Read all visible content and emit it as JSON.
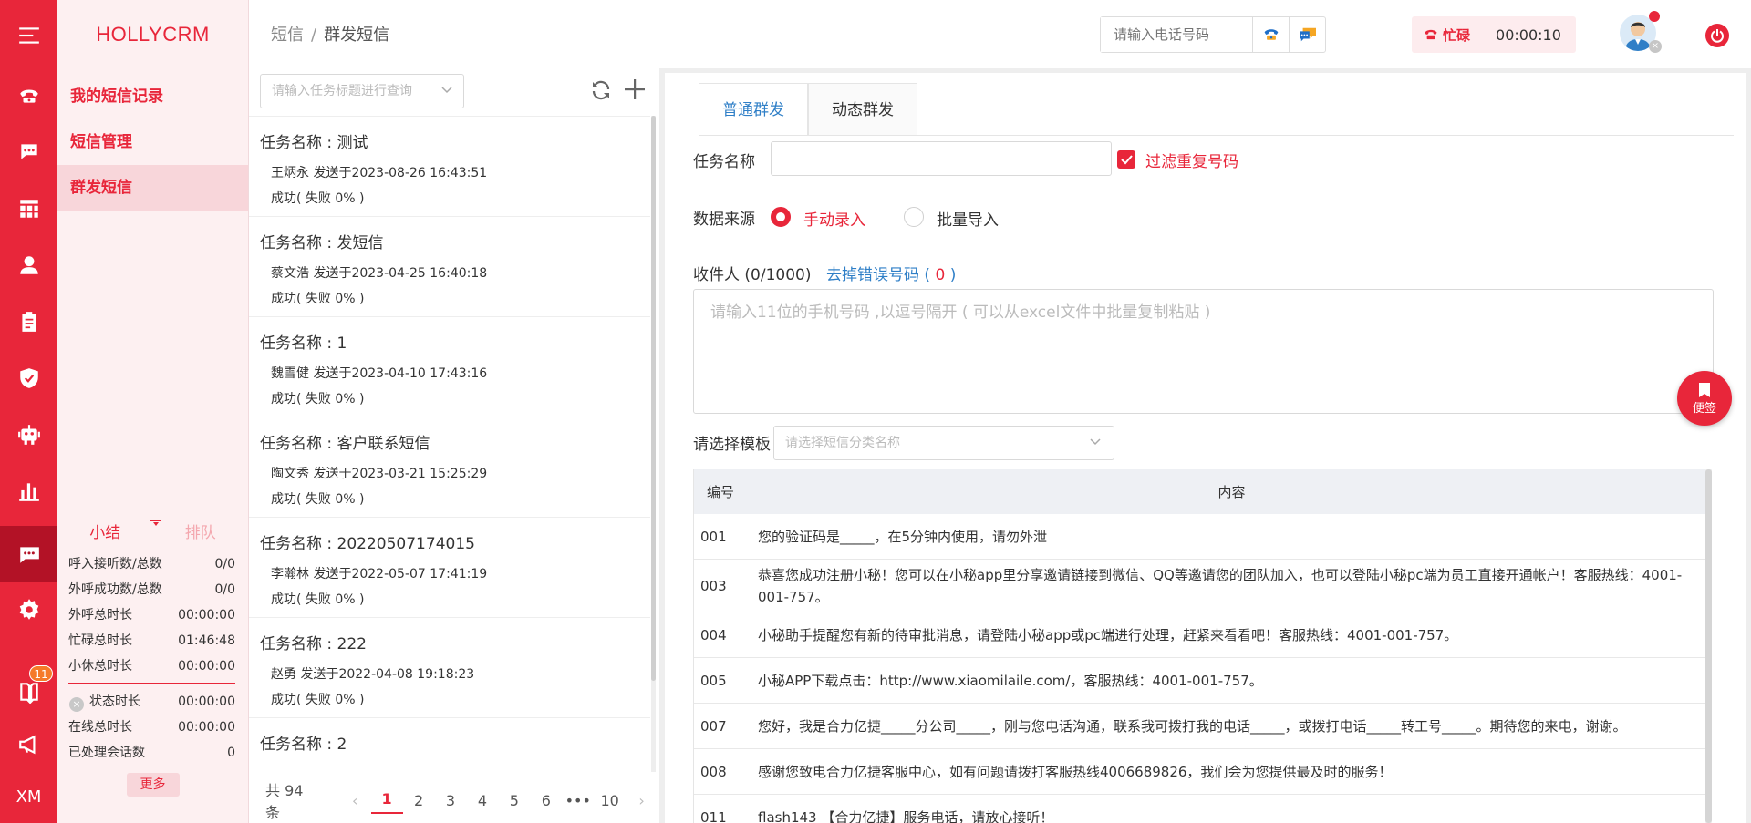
{
  "brand": "HOLLYCRM",
  "rail": {
    "items": [
      {
        "icon": "menu-icon"
      },
      {
        "icon": "phone-icon"
      },
      {
        "icon": "chat-icon"
      },
      {
        "icon": "grid-icon"
      },
      {
        "icon": "user-icon"
      },
      {
        "icon": "clipboard-icon"
      },
      {
        "icon": "shield-icon"
      },
      {
        "icon": "robot-icon"
      },
      {
        "icon": "bar-chart-icon"
      },
      {
        "icon": "message-icon",
        "active": true
      },
      {
        "icon": "gear-icon"
      },
      {
        "icon": "book-icon",
        "badge": "11"
      },
      {
        "icon": "megaphone-icon"
      },
      {
        "icon": "xm-text",
        "text": "XM"
      }
    ]
  },
  "submenu": {
    "items": [
      {
        "label": "我的短信记录"
      },
      {
        "label": "短信管理"
      },
      {
        "label": "群发短信",
        "selected": true
      }
    ]
  },
  "stats": {
    "tabs": {
      "summary": "小结",
      "queue": "排队"
    },
    "rows": [
      {
        "label": "呼入接听数/总数",
        "value": "0/0"
      },
      {
        "label": "外呼成功数/总数",
        "value": "0/0"
      },
      {
        "label": "外呼总时长",
        "value": "00:00:00"
      },
      {
        "label": "忙碌总时长",
        "value": "01:46:48"
      },
      {
        "label": "小休总时长",
        "value": "00:00:00"
      }
    ],
    "rows2": [
      {
        "label": "状态时长",
        "value": "00:00:00"
      },
      {
        "label": "在线总时长",
        "value": "00:00:00"
      },
      {
        "label": "已处理会话数",
        "value": "0"
      }
    ],
    "more": "更多"
  },
  "header": {
    "breadcrumb": {
      "parent": "短信",
      "sep": "/",
      "current": "群发短信"
    },
    "phone_placeholder": "请输入电话号码",
    "status": "忙碌",
    "timer": "00:00:10"
  },
  "tasklist": {
    "search_placeholder": "请输入任务标题进行查询",
    "items": [
      {
        "title": "任务名称 : 测试",
        "meta": "王炳永 发送于2023-08-26 16:43:51",
        "result": "成功( 失败 0% )"
      },
      {
        "title": "任务名称 : 发短信",
        "meta": "蔡文浩 发送于2023-04-25 16:40:18",
        "result": "成功( 失败 0% )"
      },
      {
        "title": "任务名称 : 1",
        "meta": "魏雪健 发送于2023-04-10 17:43:16",
        "result": "成功( 失败 0% )"
      },
      {
        "title": "任务名称 : 客户联系短信",
        "meta": "陶文秀 发送于2023-03-21 15:25:29",
        "result": "成功( 失败 0% )"
      },
      {
        "title": "任务名称 : 20220507174015",
        "meta": "李瀚林 发送于2022-05-07 17:41:19",
        "result": "成功( 失败 0% )"
      },
      {
        "title": "任务名称 : 222",
        "meta": "赵勇 发送于2022-04-08 19:18:23",
        "result": "成功( 失败 0% )"
      },
      {
        "title": "任务名称 : 2",
        "meta": "",
        "result": ""
      }
    ],
    "pager": {
      "total": "共 94 条",
      "pages": [
        "1",
        "2",
        "3",
        "4",
        "5",
        "6",
        "•••",
        "10"
      ],
      "current": "1"
    }
  },
  "form": {
    "tabs": [
      "普通群发",
      "动态群发"
    ],
    "task_name_label": "任务名称",
    "filter_dup_label": "过滤重复号码",
    "source_label": "数据来源",
    "source_manual": "手动录入",
    "source_batch": "批量导入",
    "recipients_label": "收件人 (0/1000)",
    "remove_errors_label": "去掉错误号码 (",
    "remove_errors_count": "0",
    "remove_errors_close": ")",
    "recipients_placeholder": "请输入11位的手机号码 ,以逗号隔开 ( 可以从excel文件中批量复制粘贴 )",
    "template_label": "请选择模板",
    "template_placeholder": "请选择短信分类名称"
  },
  "templates": {
    "headers": {
      "no": "编号",
      "content": "内容"
    },
    "rows": [
      {
        "no": "001",
        "content": "您的验证码是_____，在5分钟内使用，请勿外泄"
      },
      {
        "no": "003",
        "content": "恭喜您成功注册小秘！您可以在小秘app里分享邀请链接到微信、QQ等邀请您的团队加入，也可以登陆小秘pc端为员工直接开通帐户！客服热线：4001-001-757。"
      },
      {
        "no": "004",
        "content": "小秘助手提醒您有新的待审批消息，请登陆小秘app或pc端进行处理，赶紧来看看吧！客服热线：4001-001-757。"
      },
      {
        "no": "005",
        "content": "小秘APP下载点击：http://www.xiaomilaile.com/，客服热线：4001-001-757。"
      },
      {
        "no": "007",
        "content": "您好，我是合力亿捷_____分公司_____，刚与您电话沟通，联系我可拨打我的电话_____，或拨打电话_____转工号_____。期待您的来电，谢谢。"
      },
      {
        "no": "008",
        "content": "感谢您致电合力亿捷客服中心，如有问题请拨打客服热线4006689826，我们会为您提供最及时的服务！"
      },
      {
        "no": "011",
        "content": "flash143 【合力亿捷】服务电话，请放心接听！"
      }
    ]
  },
  "sticky_note": "便签",
  "colors": {
    "accent": "#e8263a",
    "link": "#2f7fc7"
  }
}
